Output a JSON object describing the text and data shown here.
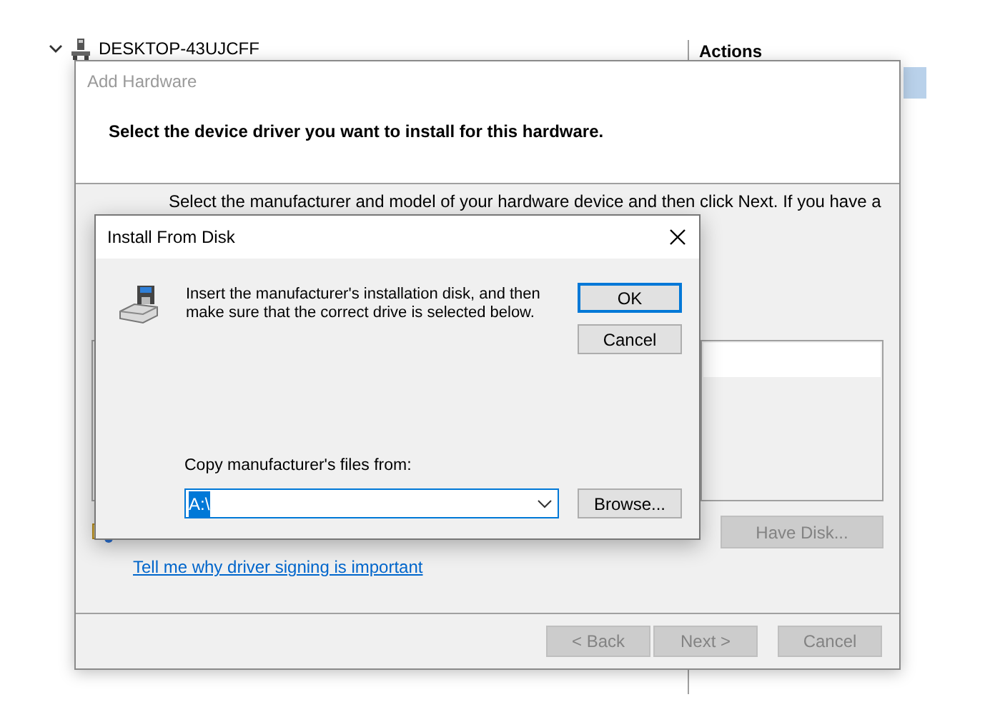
{
  "tree_item": {
    "label": "DESKTOP-43UJCFF",
    "expanded": true
  },
  "actions_panel": {
    "title": "Actions"
  },
  "wizard": {
    "title": "Add Hardware",
    "heading": "Select the device driver you want to install for this hardware.",
    "instructions": "Select the manufacturer and model of your hardware device and then click Next. If you have a",
    "link": "Tell me why driver signing is important",
    "have_disk_button": {
      "label": "Have Disk...",
      "disabled": true
    },
    "buttons": [
      {
        "label": "< Back",
        "disabled": true
      },
      {
        "label": "Next >",
        "disabled": true
      },
      {
        "label": "Cancel",
        "disabled": true
      }
    ]
  },
  "dialog": {
    "title": "Install From Disk",
    "message": "Insert the manufacturer's installation disk, and then make sure that the correct drive is selected below.",
    "buttons": [
      {
        "label": "OK",
        "default": true
      },
      {
        "label": "Cancel",
        "default": false
      }
    ],
    "path_label": "Copy manufacturer's files from:",
    "path": {
      "value": "A:\\",
      "selected": true
    },
    "browse_button": "Browse..."
  }
}
